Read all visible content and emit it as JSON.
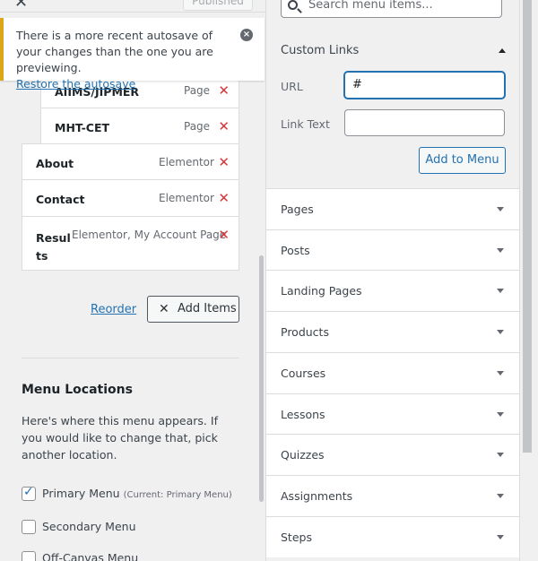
{
  "header": {
    "published_label": "Published"
  },
  "notice": {
    "message": "There is a more recent autosave of your changes than the one you are previewing.",
    "link": "Restore the autosave"
  },
  "menu_items": [
    {
      "title": "AIIMS/JIPMER",
      "type": "Page"
    },
    {
      "title": "MHT-CET",
      "type": "Page"
    },
    {
      "title": "About",
      "type": "Elementor"
    },
    {
      "title": "Contact",
      "type": "Elementor"
    },
    {
      "title": "Resul ts",
      "type": "Elementor, My Account Page"
    }
  ],
  "actions": {
    "reorder": "Reorder",
    "add_items": "Add Items"
  },
  "locations": {
    "title": "Menu Locations",
    "description": "Here's where this menu appears. If you would like to change that, pick another location.",
    "items": [
      {
        "label": "Primary Menu",
        "note": "(Current: Primary Menu)",
        "checked": true
      },
      {
        "label": "Secondary Menu",
        "note": "",
        "checked": false
      },
      {
        "label": "Off-Canvas Menu",
        "note": "",
        "checked": false
      }
    ]
  },
  "search": {
    "placeholder": "Search menu items..."
  },
  "custom_links": {
    "title": "Custom Links",
    "url_label": "URL",
    "url_value": "#",
    "link_text_label": "Link Text",
    "link_text_value": "",
    "add_button": "Add to Menu"
  },
  "accordion": [
    "Pages",
    "Posts",
    "Landing Pages",
    "Products",
    "Courses",
    "Lessons",
    "Quizzes",
    "Assignments",
    "Steps"
  ]
}
